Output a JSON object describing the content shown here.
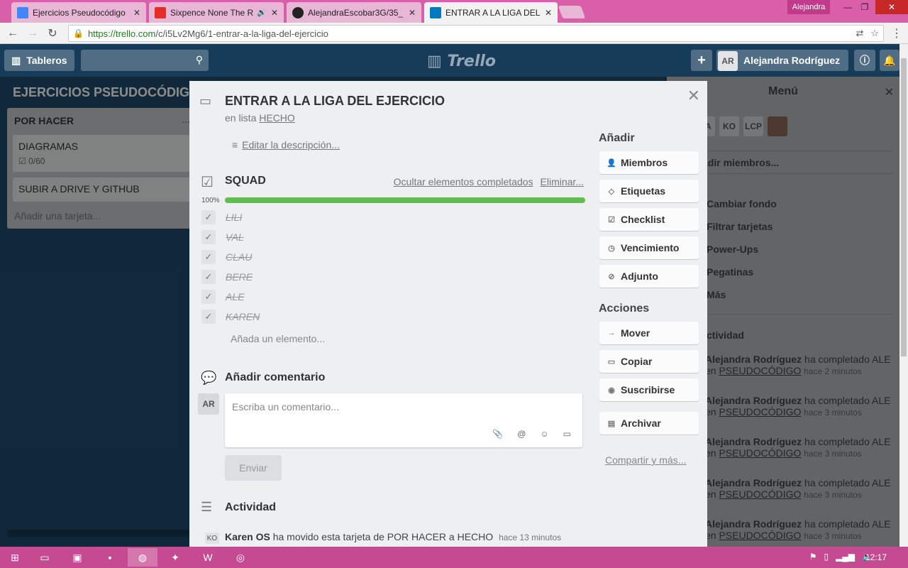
{
  "browser": {
    "tabs": [
      {
        "title": "Ejercicios Pseudocódigo",
        "favicon": "docs-icon",
        "color": "#4285f4"
      },
      {
        "title": "Sixpence None The R",
        "favicon": "youtube-icon",
        "color": "#e52d27",
        "audio": "🔊"
      },
      {
        "title": "AlejandraEscobar3G/35_",
        "favicon": "github-icon",
        "color": "#222222"
      },
      {
        "title": "ENTRAR A LA LIGA DEL E",
        "favicon": "trello-icon",
        "color": "#0079bf"
      }
    ],
    "close_glyph": "✕",
    "profile": "Alejandra",
    "url_host": "https://trello.com",
    "url_path": "/c/i5Lv2Mg6/1-entrar-a-la-liga-del-ejercicio"
  },
  "header": {
    "boards_label": "Tableros",
    "logo": "Trello",
    "plus": "+",
    "avatar": "AR",
    "user_name": "Alejandra Rodríguez",
    "info": "ⓘ"
  },
  "board": {
    "title": "EJERCICIOS PSEUDOCÓDIGO",
    "list": {
      "title": "POR HACER",
      "menu": "...",
      "cards": [
        {
          "title": "DIAGRAMAS",
          "badge": "0/60"
        },
        {
          "title": "SUBIR A DRIVE Y GITHUB"
        }
      ],
      "add_card": "Añadir una tarjeta..."
    }
  },
  "menu": {
    "title": "Menú",
    "avatars": [
      "BA",
      "KO",
      "LCP"
    ],
    "add_members": "adir miembros...",
    "items": [
      "Cambiar fondo",
      "Filtrar tarjetas",
      "Power-Ups",
      "Pegatinas",
      "Más"
    ],
    "activity_title": "ctividad",
    "activity": [
      {
        "user": "Alejandra Rodríguez",
        "action": "ha completado ALE",
        "prep": "en",
        "link": "PSEUDOCÓDIGO",
        "time": "hace 2 minutos"
      },
      {
        "user": "Alejandra Rodríguez",
        "action": "ha completado ALE",
        "prep": "en",
        "link": "PSEUDOCÓDIGO",
        "time": "hace 3 minutos"
      },
      {
        "user": "Alejandra Rodríguez",
        "action": "ha completado ALE",
        "prep": "en",
        "link": "PSEUDOCÓDIGO",
        "time": "hace 3 minutos"
      },
      {
        "user": "Alejandra Rodríguez",
        "action": "ha completado ALE",
        "prep": "en",
        "link": "PSEUDOCÓDIGO",
        "time": "hace 3 minutos"
      },
      {
        "user": "Alejandra Rodríguez",
        "action": "ha completado ALE",
        "prep": "en",
        "link": "PSEUDOCÓDIGO",
        "time": "hace 3 minutos"
      }
    ]
  },
  "card": {
    "title": "ENTRAR A LA LIGA DEL EJERCICIO",
    "in_list_prefix": "en lista",
    "list_name": "HECHO",
    "edit_description": "Editar la descripción...",
    "checklist": {
      "title": "SQUAD",
      "hide_completed": "Ocultar elementos completados",
      "delete": "Eliminar...",
      "progress_label": "100%",
      "progress": 1.0,
      "items": [
        "LILI",
        "VAL",
        "CLAU",
        "BERE",
        "ALE",
        "KAREN"
      ],
      "add_item": "Añada un elemento..."
    },
    "comment": {
      "title": "Añadir comentario",
      "avatar": "AR",
      "placeholder": "Escriba un comentario...",
      "send": "Enviar"
    },
    "activity": {
      "title": "Actividad",
      "avatar": "KO",
      "user": "Karen OS",
      "text": "ha movido esta tarjeta de POR HACER a HECHO",
      "time": "hace 13 minutos"
    },
    "add_section": {
      "title": "Añadir",
      "buttons": [
        "Miembros",
        "Etiquetas",
        "Checklist",
        "Vencimiento",
        "Adjunto"
      ]
    },
    "actions_section": {
      "title": "Acciones",
      "buttons": [
        "Mover",
        "Copiar",
        "Suscribirse",
        "Archivar"
      ]
    },
    "share": "Compartir y más..."
  },
  "taskbar": {
    "clock": "12:17"
  }
}
